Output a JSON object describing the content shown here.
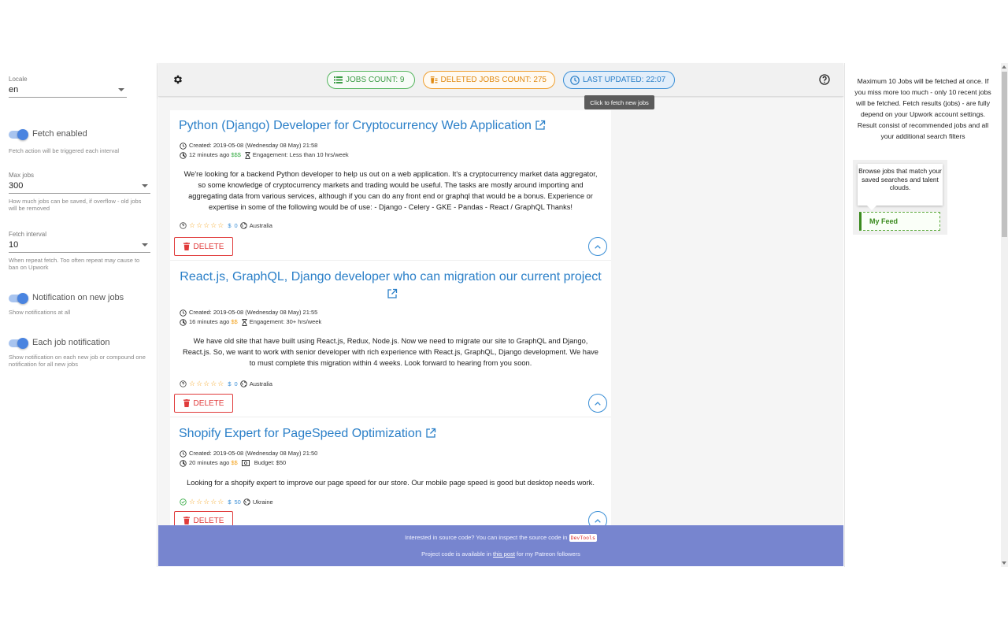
{
  "settings": {
    "locale": {
      "label": "Locale",
      "value": "en"
    },
    "fetch_enabled": {
      "label": "Fetch enabled",
      "hint": "Fetch action will be triggered each interval",
      "on": true
    },
    "max_jobs": {
      "label": "Max jobs",
      "value": "300",
      "hint": "How much jobs can be saved, if overflow - old jobs will be removed"
    },
    "fetch_interval": {
      "label": "Fetch interval",
      "value": "10",
      "hint": "When repeat fetch. Too often repeat may cause to ban on Upwork"
    },
    "notify_new": {
      "label": "Notification on new jobs",
      "hint": "Show notifications at all",
      "on": true
    },
    "each_job": {
      "label": "Each job notification",
      "hint": "Show notification on each new job or compound one notification for all new jobs",
      "on": true
    }
  },
  "toolbar": {
    "jobs_count": "JOBS COUNT: 9",
    "deleted_count": "DELETED JOBS COUNT: 275",
    "last_updated": "LAST UPDATED: 22:07",
    "tooltip": "Click to fetch new jobs",
    "colors": {
      "green": "#55b55e",
      "orange": "#f0a030",
      "blue": "#3b8fd6"
    }
  },
  "jobs": [
    {
      "title": "Python (Django) Developer for Cryptocurrency Web Application",
      "created": "Created: 2019-05-08 (Wednesday 08 May) 21:58",
      "ago": "12 minutes ago",
      "price": "$$$",
      "engagement": "Engagement: Less than 10 hrs/week",
      "description": "We're looking for a backend Python developer to help us out on a web application. It's a cryptocurrency market data aggregator, so some knowledge of cryptocurrency markets and trading would be useful. The tasks are mostly around importing and aggregating data from various services, although if you can do any front end or graphql that would be a bonus. Experience or expertise in some of the following would be of use: - Django - Celery - GKE - Pandas - React / GraphQL Thanks!",
      "stars": "☆☆☆☆☆",
      "spent": "0",
      "country": "Australia",
      "delete": "DELETE"
    },
    {
      "title": "React.js, GraphQL, Django developer who can migration our current project",
      "created": "Created: 2019-05-08 (Wednesday 08 May) 21:55",
      "ago": "16 minutes ago",
      "price": "$$",
      "engagement": "Engagement: 30+ hrs/week",
      "description": "We have old site that have built using React.js, Redux, Node.js. Now we need to migrate our site to GraphQL and Django, React.js. So, we want to work with senior developer with rich experience with React.js, GraphQL, Django development. We have to must complete this migration within 4 weeks. Look forward to hearing from you soon.",
      "stars": "☆☆☆☆☆",
      "spent": "0",
      "country": "Australia",
      "delete": "DELETE"
    },
    {
      "title": "Shopify Expert for PageSpeed Optimization",
      "created": "Created: 2019-05-08 (Wednesday 08 May) 21:50",
      "ago": "20 minutes ago",
      "price": "$$",
      "engagement": "Budget: $50",
      "description": "Looking for a shopify expert to improve our page speed for our store. Our mobile page speed is good but desktop needs work.",
      "stars": "☆☆☆☆☆",
      "spent": "50",
      "country": "Ukraine",
      "delete": "DELETE"
    }
  ],
  "banner": {
    "line1_before": "Interested in source code? You can inspect the source code in",
    "devtools": "DevTools",
    "line2_before": "Project code is available in",
    "link": "this post",
    "line2_after": "for my Patreon followers"
  },
  "right_panel": {
    "info": "Maximum 10 Jobs will be fetched at once. If you miss more too much - only 10 recent jobs will be fetched. Fetch results (jobs) - are fully depend on your Upwork account settings. Result consist of recommended jobs and all your additional search filters",
    "bubble": "Browse jobs that match your saved searches and talent clouds.",
    "feed_button": "My Feed"
  }
}
